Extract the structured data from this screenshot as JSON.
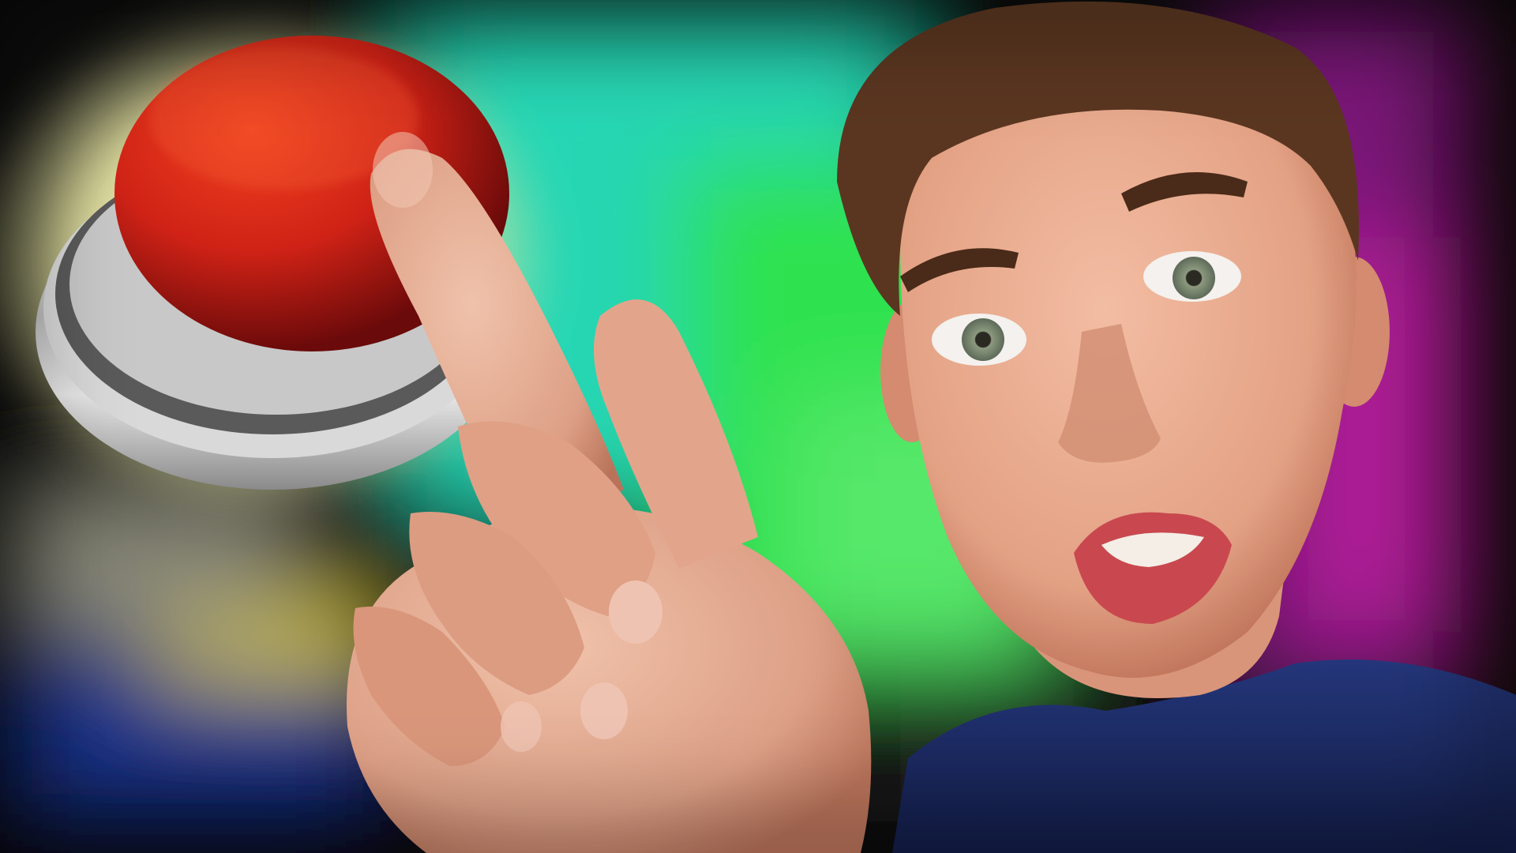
{
  "image": {
    "kind": "photo-thumbnail",
    "subjects": [
      "red-push-button",
      "pointing-hand",
      "person-face"
    ],
    "palette": {
      "background_green": "#2fd06a",
      "background_teal": "#29d3b0",
      "background_magenta": "#8a1a8a",
      "background_yellow_glow": "#f3f1b0",
      "button_red": "#d8281b",
      "button_red_dark": "#8a0f0f",
      "button_base_silver": "#c9c9c9",
      "skin": "#e9a98c",
      "skin_shadow": "#c77d63",
      "hair": "#5a3620",
      "shirt": "#1d2c68",
      "lips": "#d9535a",
      "iris": "#7c8a74"
    }
  }
}
